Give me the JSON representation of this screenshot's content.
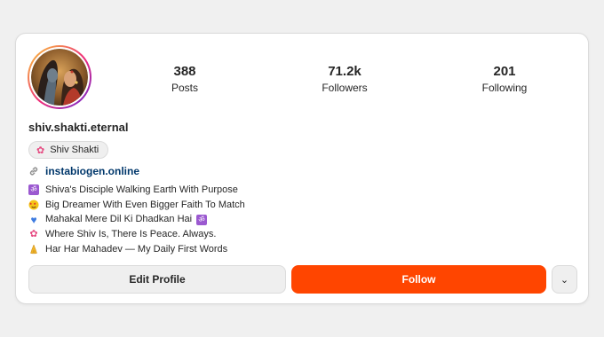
{
  "profile": {
    "username": "shiv.shakti.eternal",
    "avatar_icon": "avatar-portrait",
    "chip": {
      "icon": "flower-icon",
      "label": "Shiv Shakti"
    },
    "link": {
      "icon": "link-icon",
      "text": "instabiogen.online"
    }
  },
  "stats": [
    {
      "value": "388",
      "label": "Posts"
    },
    {
      "value": "71.2k",
      "label": "Followers"
    },
    {
      "value": "201",
      "label": "Following"
    }
  ],
  "bio": [
    {
      "icon": "om-icon",
      "text": "Shiva's Disciple Walking Earth With Purpose"
    },
    {
      "icon": "star-struck-icon",
      "text": "Big Dreamer With Even Bigger Faith To Match"
    },
    {
      "icon": "blue-heart-icon",
      "text": "Mahakal Mere Dil Ki Dhadkan Hai",
      "trailing_icon": "om-icon"
    },
    {
      "icon": "flower-icon",
      "text": "Where Shiv Is, There Is Peace. Always."
    },
    {
      "icon": "folded-hands-icon",
      "text": "Har Har Mahadev — My Daily First Words"
    }
  ],
  "actions": {
    "edit_label": "Edit Profile",
    "follow_label": "Follow",
    "more_label": "⌄"
  },
  "colors": {
    "follow": "#ff4500",
    "link": "#00376b",
    "button_gray": "#efefef"
  }
}
